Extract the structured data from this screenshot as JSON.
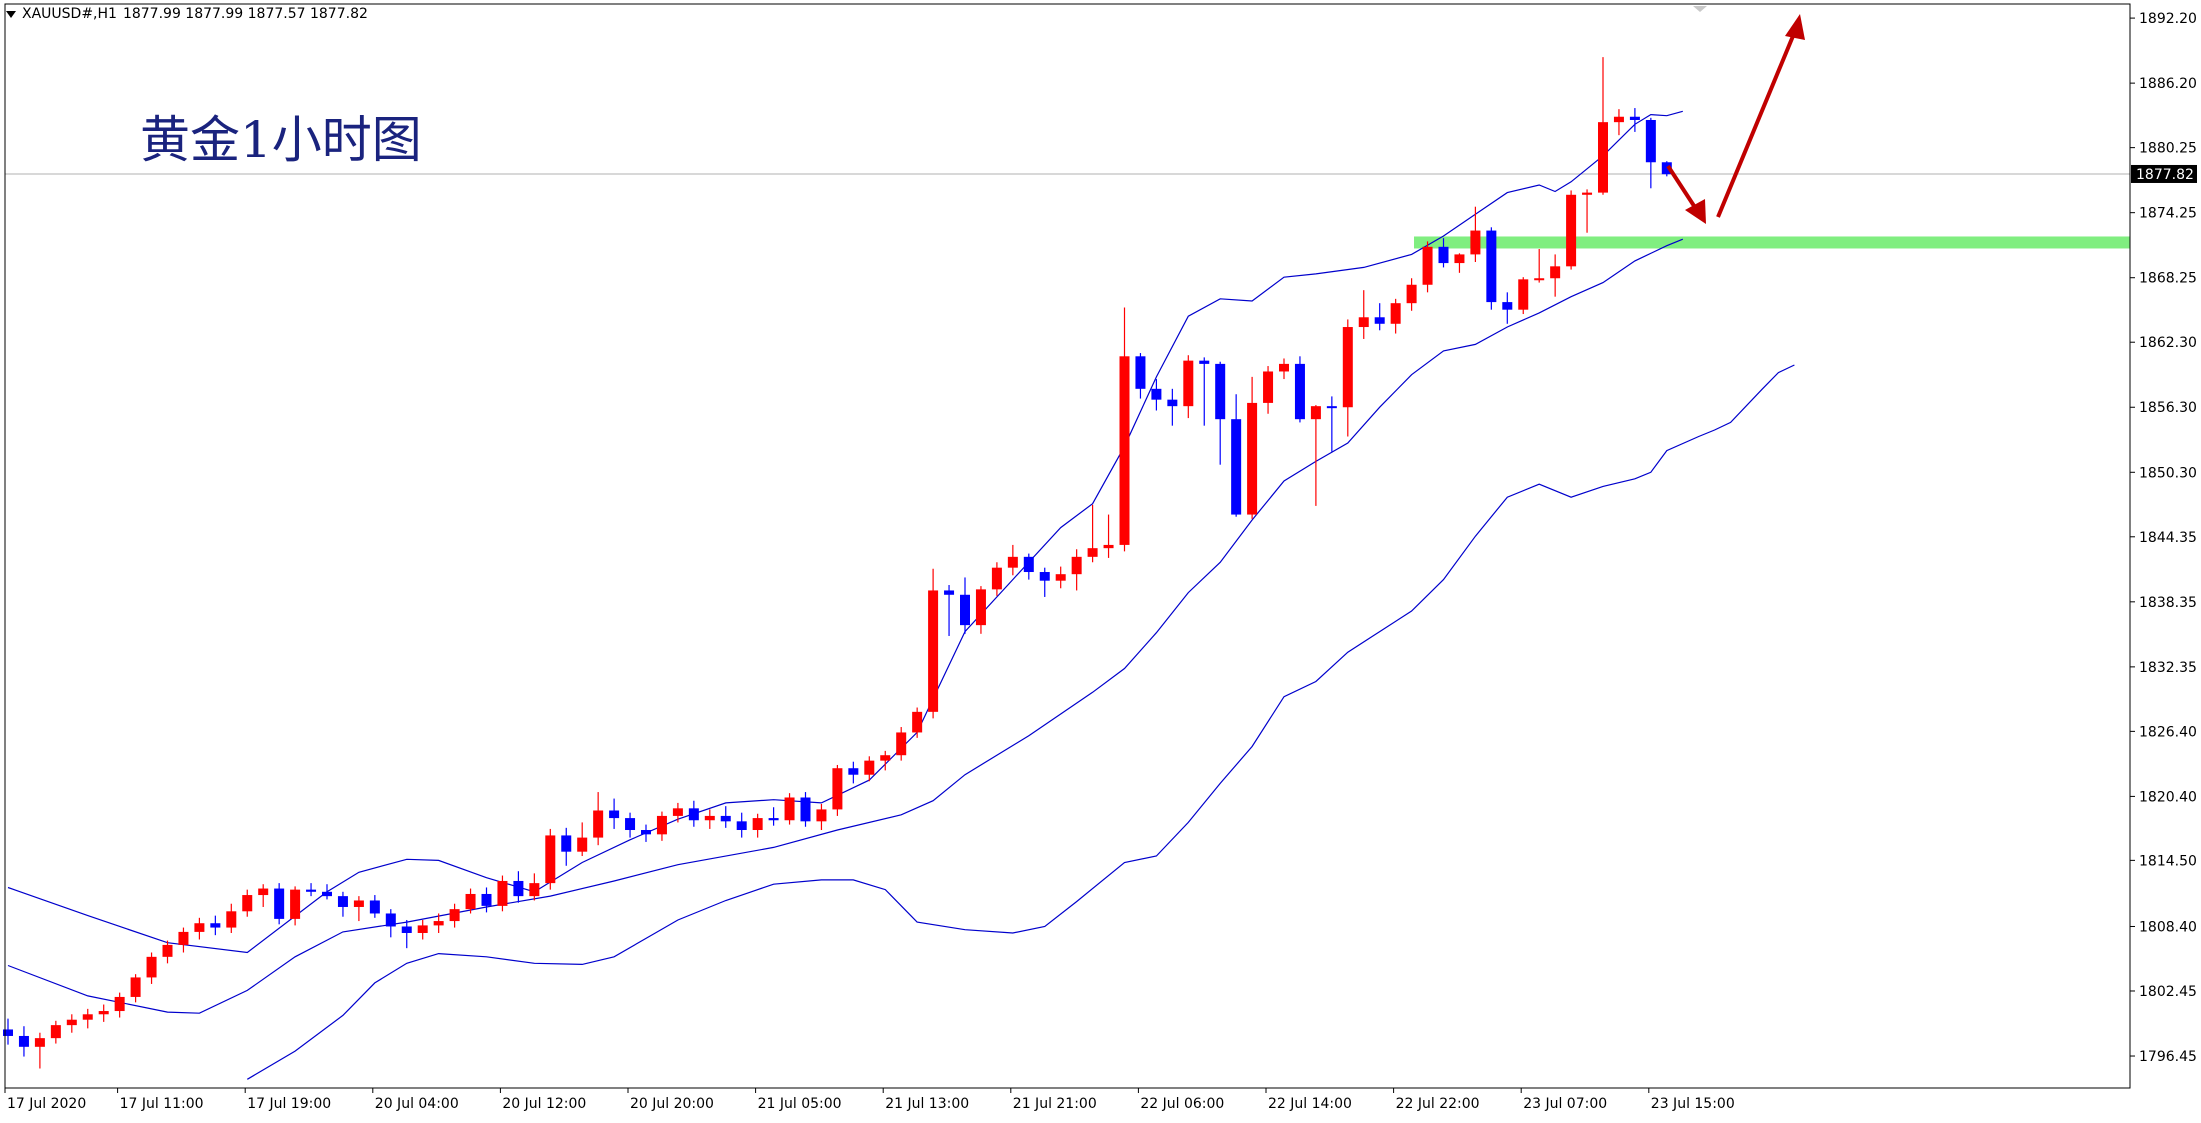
{
  "header": {
    "symbol": "XAUUSD#,H1",
    "ohlc": "1877.99 1877.99 1877.57 1877.82"
  },
  "annotation": "黄金1小时图",
  "current_price_label": "1877.82",
  "colors": {
    "bull": "#ff0000",
    "bear": "#0000ff",
    "bands": "#0000cc",
    "support": "#80ee80",
    "arrow": "#c00000",
    "price_line": "#b0b0b0",
    "grid_text": "#000000"
  },
  "y_ticks": [
    "1892.20",
    "1886.20",
    "1880.25",
    "1874.25",
    "1868.25",
    "1862.30",
    "1856.30",
    "1850.30",
    "1844.35",
    "1838.35",
    "1832.35",
    "1826.40",
    "1820.40",
    "1814.50",
    "1808.40",
    "1802.45",
    "1796.45"
  ],
  "x_ticks": [
    "17 Jul 2020",
    "17 Jul 11:00",
    "17 Jul 19:00",
    "20 Jul 04:00",
    "20 Jul 12:00",
    "20 Jul 20:00",
    "21 Jul 05:00",
    "21 Jul 13:00",
    "21 Jul 21:00",
    "22 Jul 06:00",
    "22 Jul 14:00",
    "22 Jul 22:00",
    "23 Jul 07:00",
    "23 Jul 15:00"
  ],
  "chart_data": {
    "type": "candlestick",
    "title": "黄金1小时图",
    "symbol": "XAUUSD#,H1",
    "timeframe": "H1",
    "ylim": [
      1793.5,
      1893.5
    ],
    "current_price": 1877.82,
    "support_level": 1871.5,
    "candles": [
      [
        1798.9,
        1799.9,
        1797.5,
        1798.3
      ],
      [
        1798.3,
        1799.2,
        1796.4,
        1797.3
      ],
      [
        1797.3,
        1798.6,
        1795.3,
        1798.1
      ],
      [
        1798.1,
        1799.7,
        1797.6,
        1799.3
      ],
      [
        1799.3,
        1800.3,
        1798.6,
        1799.8
      ],
      [
        1799.8,
        1800.8,
        1799.0,
        1800.3
      ],
      [
        1800.3,
        1801.2,
        1799.6,
        1800.6
      ],
      [
        1800.6,
        1802.3,
        1800.0,
        1801.9
      ],
      [
        1801.9,
        1804.0,
        1801.4,
        1803.7
      ],
      [
        1803.7,
        1806.0,
        1803.1,
        1805.6
      ],
      [
        1805.6,
        1807.1,
        1805.0,
        1806.7
      ],
      [
        1806.7,
        1808.3,
        1806.0,
        1807.9
      ],
      [
        1807.9,
        1809.2,
        1807.2,
        1808.7
      ],
      [
        1808.7,
        1809.4,
        1807.6,
        1808.3
      ],
      [
        1808.3,
        1810.5,
        1807.8,
        1809.8
      ],
      [
        1809.8,
        1811.8,
        1809.3,
        1811.3
      ],
      [
        1811.3,
        1812.3,
        1810.2,
        1811.9
      ],
      [
        1811.9,
        1812.4,
        1808.6,
        1809.1
      ],
      [
        1809.1,
        1812.1,
        1808.5,
        1811.8
      ],
      [
        1811.8,
        1812.4,
        1811.2,
        1811.6
      ],
      [
        1811.6,
        1812.3,
        1810.9,
        1811.2
      ],
      [
        1811.2,
        1811.6,
        1809.3,
        1810.2
      ],
      [
        1810.2,
        1811.2,
        1808.9,
        1810.8
      ],
      [
        1810.8,
        1811.3,
        1809.2,
        1809.6
      ],
      [
        1809.6,
        1810.0,
        1807.4,
        1808.4
      ],
      [
        1808.4,
        1809.0,
        1806.4,
        1807.8
      ],
      [
        1807.8,
        1809.0,
        1807.2,
        1808.5
      ],
      [
        1808.5,
        1809.6,
        1807.8,
        1808.9
      ],
      [
        1808.9,
        1810.5,
        1808.3,
        1810.0
      ],
      [
        1810.0,
        1811.9,
        1809.6,
        1811.4
      ],
      [
        1811.4,
        1812.0,
        1809.7,
        1810.3
      ],
      [
        1810.3,
        1813.1,
        1809.8,
        1812.6
      ],
      [
        1812.6,
        1813.5,
        1810.6,
        1811.2
      ],
      [
        1811.2,
        1813.3,
        1810.8,
        1812.4
      ],
      [
        1812.4,
        1817.4,
        1811.8,
        1816.8
      ],
      [
        1816.8,
        1817.5,
        1814.0,
        1815.3
      ],
      [
        1815.3,
        1818.0,
        1814.9,
        1816.6
      ],
      [
        1816.6,
        1820.8,
        1815.9,
        1819.1
      ],
      [
        1819.1,
        1820.2,
        1817.4,
        1818.4
      ],
      [
        1818.4,
        1818.9,
        1816.6,
        1817.3
      ],
      [
        1817.3,
        1817.8,
        1816.2,
        1816.9
      ],
      [
        1816.9,
        1819.0,
        1816.3,
        1818.6
      ],
      [
        1818.6,
        1819.8,
        1818.0,
        1819.3
      ],
      [
        1819.3,
        1820.0,
        1817.6,
        1818.2
      ],
      [
        1818.2,
        1819.2,
        1817.4,
        1818.6
      ],
      [
        1818.6,
        1819.5,
        1817.5,
        1818.1
      ],
      [
        1818.1,
        1818.9,
        1816.6,
        1817.3
      ],
      [
        1817.3,
        1818.8,
        1816.6,
        1818.4
      ],
      [
        1818.4,
        1819.4,
        1817.7,
        1818.2
      ],
      [
        1818.2,
        1820.7,
        1817.8,
        1820.3
      ],
      [
        1820.3,
        1820.8,
        1817.6,
        1818.1
      ],
      [
        1818.1,
        1819.7,
        1817.3,
        1819.2
      ],
      [
        1819.2,
        1823.3,
        1818.6,
        1823.0
      ],
      [
        1823.0,
        1823.6,
        1821.6,
        1822.4
      ],
      [
        1822.4,
        1824.1,
        1821.8,
        1823.7
      ],
      [
        1823.7,
        1824.6,
        1822.8,
        1824.2
      ],
      [
        1824.2,
        1826.8,
        1823.7,
        1826.3
      ],
      [
        1826.3,
        1828.6,
        1825.8,
        1828.2
      ],
      [
        1828.2,
        1841.4,
        1827.6,
        1839.4
      ],
      [
        1839.4,
        1839.9,
        1835.2,
        1839.0
      ],
      [
        1839.0,
        1840.6,
        1835.4,
        1836.2
      ],
      [
        1836.2,
        1839.8,
        1835.4,
        1839.5
      ],
      [
        1839.5,
        1842.0,
        1838.9,
        1841.5
      ],
      [
        1841.5,
        1843.6,
        1840.8,
        1842.5
      ],
      [
        1842.5,
        1842.8,
        1840.4,
        1841.1
      ],
      [
        1841.1,
        1841.5,
        1838.8,
        1840.3
      ],
      [
        1840.3,
        1841.6,
        1839.6,
        1840.9
      ],
      [
        1840.9,
        1843.2,
        1839.4,
        1842.5
      ],
      [
        1842.5,
        1847.3,
        1842.0,
        1843.3
      ],
      [
        1843.3,
        1846.4,
        1842.4,
        1843.6
      ],
      [
        1843.6,
        1865.5,
        1843.0,
        1861.0
      ],
      [
        1861.0,
        1861.3,
        1857.1,
        1858.0
      ],
      [
        1858.0,
        1858.9,
        1856.0,
        1857.0
      ],
      [
        1857.0,
        1858.0,
        1854.6,
        1856.4
      ],
      [
        1856.4,
        1861.1,
        1855.3,
        1860.6
      ],
      [
        1860.6,
        1860.9,
        1854.6,
        1860.3
      ],
      [
        1860.3,
        1860.5,
        1851.0,
        1855.2
      ],
      [
        1855.2,
        1857.5,
        1846.2,
        1846.4
      ],
      [
        1846.4,
        1859.1,
        1846.0,
        1856.7
      ],
      [
        1856.7,
        1860.1,
        1855.7,
        1859.6
      ],
      [
        1859.6,
        1860.8,
        1858.9,
        1860.3
      ],
      [
        1860.3,
        1861.0,
        1854.9,
        1855.2
      ],
      [
        1855.2,
        1856.5,
        1847.2,
        1856.4
      ],
      [
        1856.4,
        1857.3,
        1852.2,
        1856.3
      ],
      [
        1856.3,
        1864.4,
        1853.6,
        1863.7
      ],
      [
        1863.7,
        1867.1,
        1862.6,
        1864.6
      ],
      [
        1864.6,
        1865.9,
        1863.4,
        1864.0
      ],
      [
        1864.0,
        1866.3,
        1863.1,
        1865.9
      ],
      [
        1865.9,
        1868.2,
        1865.2,
        1867.6
      ],
      [
        1867.6,
        1871.6,
        1866.9,
        1871.1
      ],
      [
        1871.1,
        1871.9,
        1869.2,
        1869.6
      ],
      [
        1869.6,
        1870.5,
        1868.7,
        1870.4
      ],
      [
        1870.4,
        1874.8,
        1869.7,
        1872.6
      ],
      [
        1872.6,
        1872.9,
        1865.3,
        1866.0
      ],
      [
        1866.0,
        1866.9,
        1864.0,
        1865.3
      ],
      [
        1865.3,
        1868.3,
        1864.9,
        1868.1
      ],
      [
        1868.1,
        1870.9,
        1867.8,
        1868.2
      ],
      [
        1868.2,
        1870.4,
        1866.5,
        1869.3
      ],
      [
        1869.3,
        1876.3,
        1869.0,
        1875.9
      ],
      [
        1875.9,
        1876.4,
        1872.4,
        1876.1
      ],
      [
        1876.1,
        1888.6,
        1875.9,
        1882.6
      ],
      [
        1882.6,
        1883.8,
        1881.4,
        1883.1
      ],
      [
        1883.1,
        1883.9,
        1881.7,
        1882.8
      ],
      [
        1882.8,
        1883.0,
        1876.5,
        1878.9
      ],
      [
        1878.9,
        1879.0,
        1877.6,
        1877.8
      ]
    ],
    "bollinger": {
      "period_note": "upper / middle / lower bands",
      "upper": [
        [
          0,
          1812.0
        ],
        [
          5,
          1809.4
        ],
        [
          10,
          1806.9
        ],
        [
          15,
          1806.0
        ],
        [
          20,
          1811.6
        ],
        [
          22,
          1813.4
        ],
        [
          25,
          1814.6
        ],
        [
          27,
          1814.5
        ],
        [
          30,
          1812.9
        ],
        [
          33,
          1811.6
        ],
        [
          36,
          1814.3
        ],
        [
          39,
          1816.4
        ],
        [
          42,
          1818.3
        ],
        [
          45,
          1819.8
        ],
        [
          48,
          1820.1
        ],
        [
          51,
          1819.8
        ],
        [
          54,
          1821.9
        ],
        [
          57,
          1826.3
        ],
        [
          60,
          1835.6
        ],
        [
          63,
          1840.4
        ],
        [
          66,
          1845.2
        ],
        [
          68,
          1847.4
        ],
        [
          70,
          1852.7
        ],
        [
          72,
          1859.1
        ],
        [
          74,
          1864.7
        ],
        [
          76,
          1866.3
        ],
        [
          78,
          1866.1
        ],
        [
          80,
          1868.3
        ],
        [
          82,
          1868.6
        ],
        [
          85,
          1869.2
        ],
        [
          88,
          1870.4
        ],
        [
          90,
          1872.1
        ],
        [
          92,
          1874.1
        ],
        [
          94,
          1876.1
        ],
        [
          96,
          1876.8
        ],
        [
          97,
          1876.2
        ],
        [
          98,
          1877.1
        ],
        [
          100,
          1879.5
        ],
        [
          102,
          1882.4
        ],
        [
          103,
          1883.3
        ],
        [
          104,
          1883.2
        ],
        [
          105,
          1883.6
        ]
      ],
      "middle": [
        [
          0,
          1804.8
        ],
        [
          5,
          1802.0
        ],
        [
          10,
          1800.5
        ],
        [
          12,
          1800.4
        ],
        [
          15,
          1802.5
        ],
        [
          18,
          1805.6
        ],
        [
          21,
          1807.9
        ],
        [
          25,
          1808.8
        ],
        [
          30,
          1810.2
        ],
        [
          34,
          1811.2
        ],
        [
          38,
          1812.6
        ],
        [
          42,
          1814.1
        ],
        [
          48,
          1815.7
        ],
        [
          52,
          1817.3
        ],
        [
          56,
          1818.7
        ],
        [
          58,
          1820.0
        ],
        [
          60,
          1822.4
        ],
        [
          64,
          1826.0
        ],
        [
          68,
          1830.0
        ],
        [
          70,
          1832.2
        ],
        [
          72,
          1835.5
        ],
        [
          74,
          1839.2
        ],
        [
          76,
          1842.0
        ],
        [
          78,
          1845.9
        ],
        [
          80,
          1849.5
        ],
        [
          82,
          1851.3
        ],
        [
          84,
          1853.0
        ],
        [
          86,
          1856.3
        ],
        [
          88,
          1859.3
        ],
        [
          90,
          1861.5
        ],
        [
          92,
          1862.1
        ],
        [
          94,
          1863.7
        ],
        [
          96,
          1865.0
        ],
        [
          98,
          1866.5
        ],
        [
          100,
          1867.8
        ],
        [
          102,
          1869.8
        ],
        [
          104,
          1871.2
        ],
        [
          105,
          1871.8
        ]
      ],
      "lower": [
        [
          15,
          1794.3
        ],
        [
          18,
          1796.9
        ],
        [
          21,
          1800.2
        ],
        [
          23,
          1803.2
        ],
        [
          25,
          1805.0
        ],
        [
          27,
          1805.9
        ],
        [
          30,
          1805.6
        ],
        [
          33,
          1805.0
        ],
        [
          36,
          1804.9
        ],
        [
          38,
          1805.6
        ],
        [
          40,
          1807.3
        ],
        [
          42,
          1809.0
        ],
        [
          45,
          1810.8
        ],
        [
          48,
          1812.3
        ],
        [
          51,
          1812.7
        ],
        [
          53,
          1812.7
        ],
        [
          55,
          1811.8
        ],
        [
          57,
          1808.8
        ],
        [
          60,
          1808.1
        ],
        [
          63,
          1807.8
        ],
        [
          65,
          1808.4
        ],
        [
          67,
          1810.7
        ],
        [
          70,
          1814.3
        ],
        [
          72,
          1814.9
        ],
        [
          74,
          1818.0
        ],
        [
          76,
          1821.6
        ],
        [
          78,
          1825.0
        ],
        [
          80,
          1829.6
        ],
        [
          82,
          1831.0
        ],
        [
          84,
          1833.7
        ],
        [
          86,
          1835.6
        ],
        [
          88,
          1837.5
        ],
        [
          90,
          1840.4
        ],
        [
          92,
          1844.4
        ],
        [
          94,
          1848.0
        ],
        [
          96,
          1849.2
        ],
        [
          98,
          1848.0
        ],
        [
          100,
          1849.0
        ],
        [
          102,
          1849.7
        ],
        [
          103,
          1850.3
        ],
        [
          104,
          1852.3
        ],
        [
          106,
          1853.6
        ],
        [
          107,
          1854.2
        ],
        [
          108,
          1854.9
        ],
        [
          110,
          1858.0
        ],
        [
          111,
          1859.5
        ],
        [
          112,
          1860.2
        ]
      ]
    }
  }
}
